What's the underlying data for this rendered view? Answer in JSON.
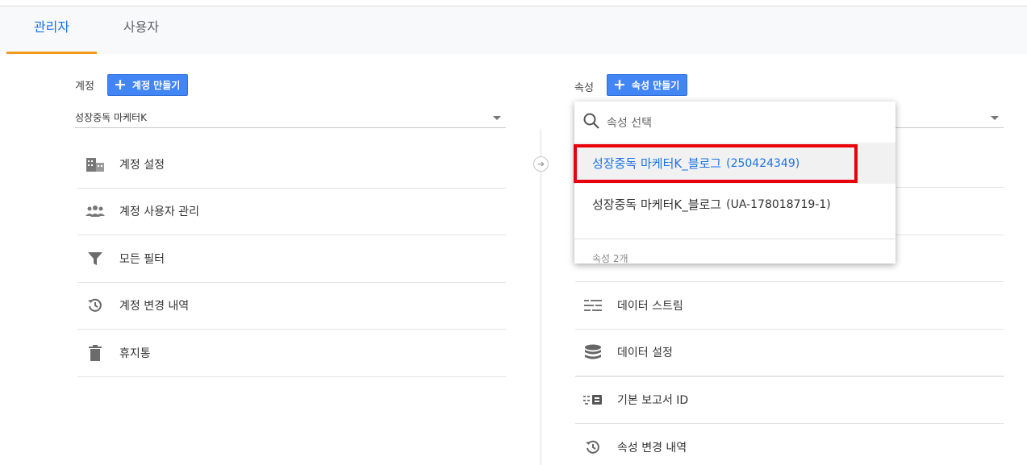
{
  "tabs": {
    "admin": "관리자",
    "user": "사용자"
  },
  "account": {
    "label": "계정",
    "create_label": "계정 만들기",
    "selected": "성장중독 마케터K",
    "menu": [
      {
        "label": "계정 설정",
        "icon": "building-icon"
      },
      {
        "label": "계정 사용자 관리",
        "icon": "people-icon"
      },
      {
        "label": "모든 필터",
        "icon": "filter-icon"
      },
      {
        "label": "계정 변경 내역",
        "icon": "history-icon"
      },
      {
        "label": "휴지통",
        "icon": "trash-icon"
      }
    ]
  },
  "property": {
    "label": "속성",
    "create_label": "속성 만들기",
    "menu": [
      {
        "label": "데이터 스트림",
        "icon": "streams-icon"
      },
      {
        "label": "데이터 설정",
        "icon": "database-icon"
      },
      {
        "label": "기본 보고서 ID",
        "icon": "report-id-icon"
      },
      {
        "label": "속성 변경 내역",
        "icon": "history-icon"
      }
    ],
    "dropdown": {
      "search_placeholder": "속성 선택",
      "options": [
        {
          "name": "성장중독 마케터K_블로그",
          "code": "(250424349)",
          "selected": true
        },
        {
          "name": "성장중독 마케터K_블로그",
          "code": "(UA-178018719-1)",
          "selected": false
        }
      ],
      "count_label": "속성 2개"
    }
  },
  "colors": {
    "accent": "#1a73e8",
    "tab_indicator": "#f29a1b",
    "button": "#4285f4",
    "highlight": "#e8000b"
  }
}
